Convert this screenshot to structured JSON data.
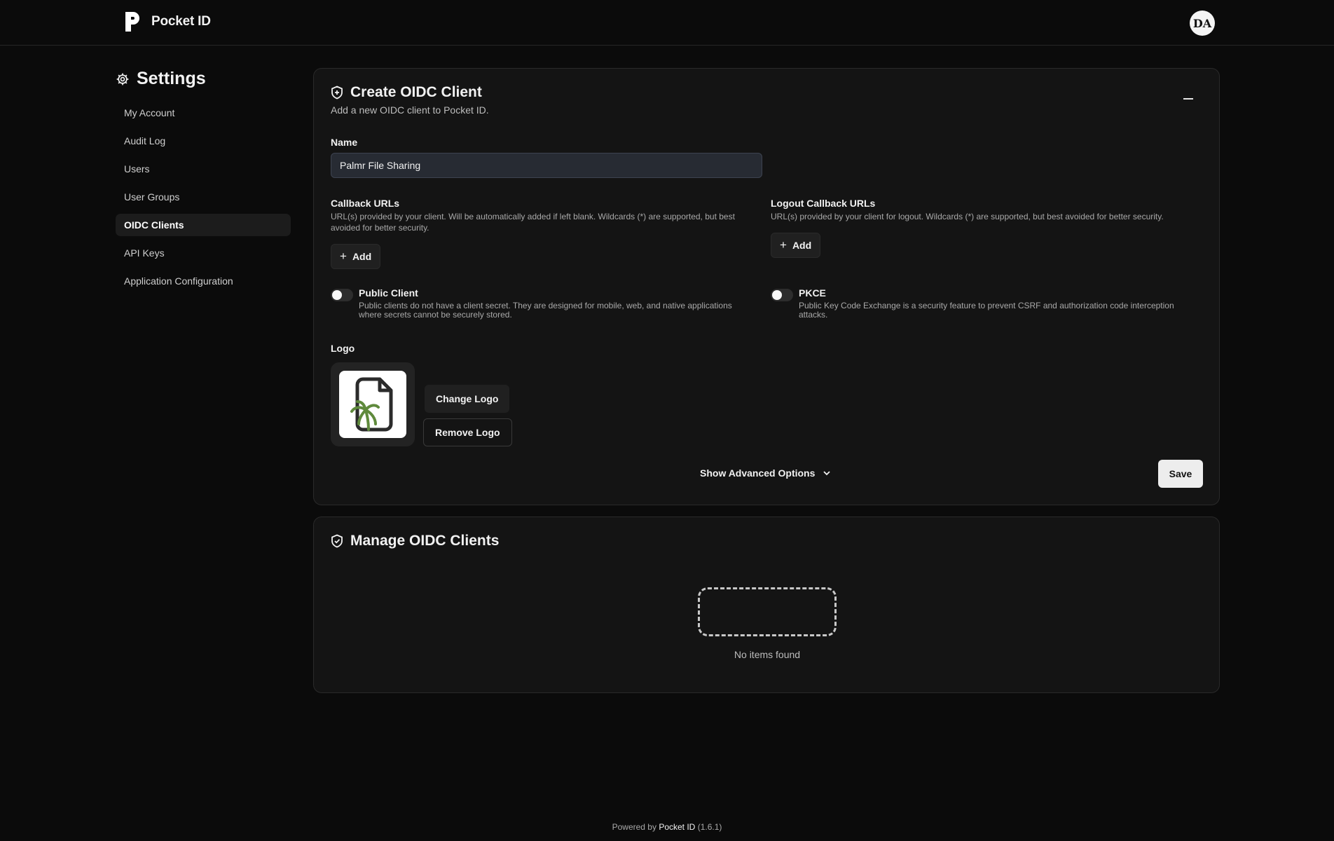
{
  "header": {
    "brand": "Pocket ID",
    "avatar_initials": "DA"
  },
  "sidebar": {
    "title": "Settings",
    "items": [
      {
        "label": "My Account"
      },
      {
        "label": "Audit Log"
      },
      {
        "label": "Users"
      },
      {
        "label": "User Groups"
      },
      {
        "label": "OIDC Clients",
        "active": true
      },
      {
        "label": "API Keys"
      },
      {
        "label": "Application Configuration"
      }
    ]
  },
  "create": {
    "title": "Create OIDC Client",
    "subtitle": "Add a new OIDC client to Pocket ID.",
    "name_label": "Name",
    "name_value": "Palmr File Sharing",
    "callback": {
      "label": "Callback URLs",
      "help": "URL(s) provided by your client. Will be automatically added if left blank. Wildcards (*) are supported, but best avoided for better security.",
      "add": "Add"
    },
    "logout_callback": {
      "label": "Logout Callback URLs",
      "help": "URL(s) provided by your client for logout. Wildcards (*) are supported, but best avoided for better security.",
      "add": "Add"
    },
    "public_client": {
      "title": "Public Client",
      "help": "Public clients do not have a client secret. They are designed for mobile, web, and native applications where secrets cannot be securely stored.",
      "enabled": false
    },
    "pkce": {
      "title": "PKCE",
      "help": "Public Key Code Exchange is a security feature to prevent CSRF and authorization code interception attacks.",
      "enabled": false
    },
    "logo_label": "Logo",
    "change_logo": "Change Logo",
    "remove_logo": "Remove Logo",
    "advanced": "Show Advanced Options",
    "save": "Save"
  },
  "manage": {
    "title": "Manage OIDC Clients",
    "empty": "No items found"
  },
  "footer": {
    "prefix": "Powered by",
    "brand": "Pocket ID",
    "version": "(1.6.1)"
  },
  "colors": {
    "background": "#0b0b0b",
    "card": "#141414",
    "logo_green": "#5f8a3c",
    "input_bg": "#272b33"
  }
}
